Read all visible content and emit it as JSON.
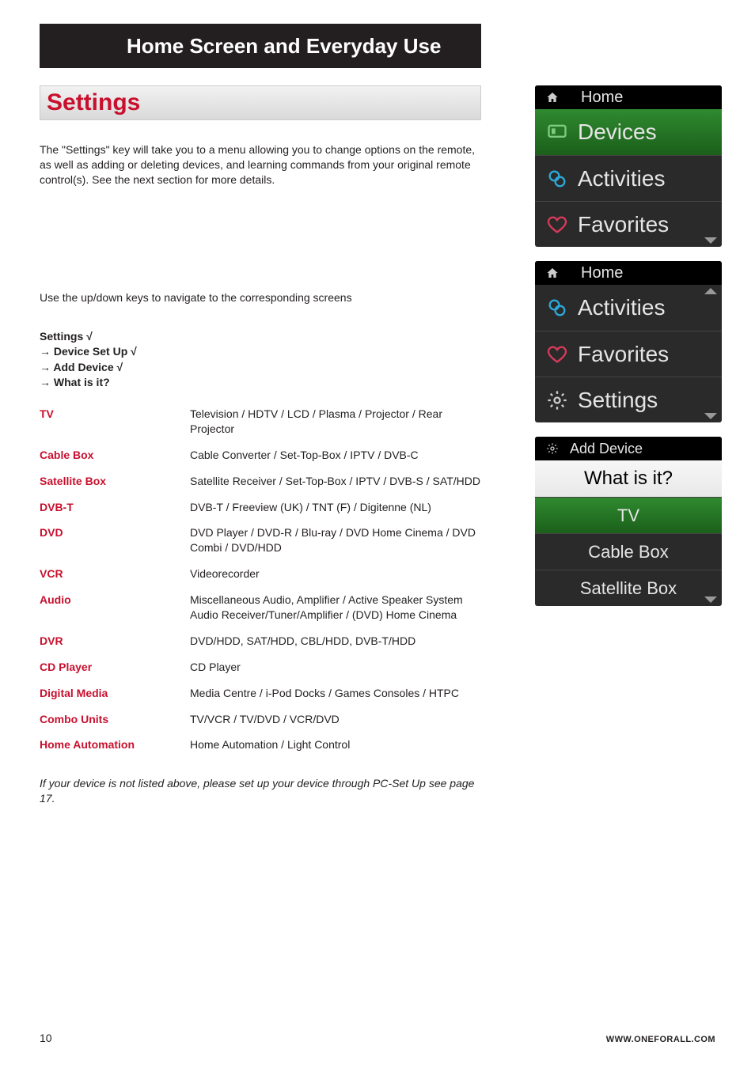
{
  "header": {
    "title": "Home Screen and Everyday Use"
  },
  "section": {
    "title": "Settings"
  },
  "intro": "The \"Settings\" key will take you to a menu allowing you to change options on the remote, as well as adding or deleting devices, and learning commands from your original remote control(s). See the next section for more details.",
  "navline": "Use the up/down keys to navigate to the corresponding screens",
  "path": {
    "l1": "Settings √",
    "l2": "→ Device Set Up √",
    "l3": "→ Add Device √",
    "l4": "→ What is it?"
  },
  "devices": [
    {
      "term": "TV",
      "desc": "Television / HDTV / LCD / Plasma / Projector / Rear Projector"
    },
    {
      "term": "Cable Box",
      "desc": "Cable Converter / Set-Top-Box / IPTV / DVB-C"
    },
    {
      "term": "Satellite Box",
      "desc": "Satellite Receiver / Set-Top-Box / IPTV / DVB-S / SAT/HDD"
    },
    {
      "term": "DVB-T",
      "desc": "DVB-T / Freeview (UK) / TNT (F) / Digitenne (NL)"
    },
    {
      "term": "DVD",
      "desc": "DVD Player / DVD-R / Blu-ray / DVD Home Cinema / DVD Combi / DVD/HDD"
    },
    {
      "term": "VCR",
      "desc": "Videorecorder"
    },
    {
      "term": "Audio",
      "desc": "Miscellaneous Audio, Amplifier / Active Speaker System Audio Receiver/Tuner/Amplifier / (DVD) Home Cinema"
    },
    {
      "term": "DVR",
      "desc": "DVD/HDD, SAT/HDD, CBL/HDD, DVB-T/HDD"
    },
    {
      "term": "CD Player",
      "desc": "CD Player"
    },
    {
      "term": "Digital Media",
      "desc": "Media Centre / i-Pod Docks / Games Consoles / HTPC"
    },
    {
      "term": "Combo Units",
      "desc": "TV/VCR / TV/DVD / VCR/DVD"
    },
    {
      "term": "Home Automation",
      "desc": "Home Automation / Light Control"
    }
  ],
  "footnote": "If your device is not listed above, please set up your device through PC-Set Up see page 17.",
  "panel1": {
    "header": "Home",
    "items": [
      {
        "label": "Devices",
        "icon": "devices-icon"
      },
      {
        "label": "Activities",
        "icon": "activities-icon"
      },
      {
        "label": "Favorites",
        "icon": "favorites-icon"
      }
    ]
  },
  "panel2": {
    "header": "Home",
    "items": [
      {
        "label": "Activities",
        "icon": "activities-icon"
      },
      {
        "label": "Favorites",
        "icon": "favorites-icon"
      },
      {
        "label": "Settings",
        "icon": "settings-icon"
      }
    ]
  },
  "panel3": {
    "header": "Add Device",
    "title": "What is it?",
    "items": [
      "TV",
      "Cable Box",
      "Satellite Box"
    ]
  },
  "footer": {
    "page_num": "10",
    "url": "WWW.ONEFORALL.COM"
  }
}
